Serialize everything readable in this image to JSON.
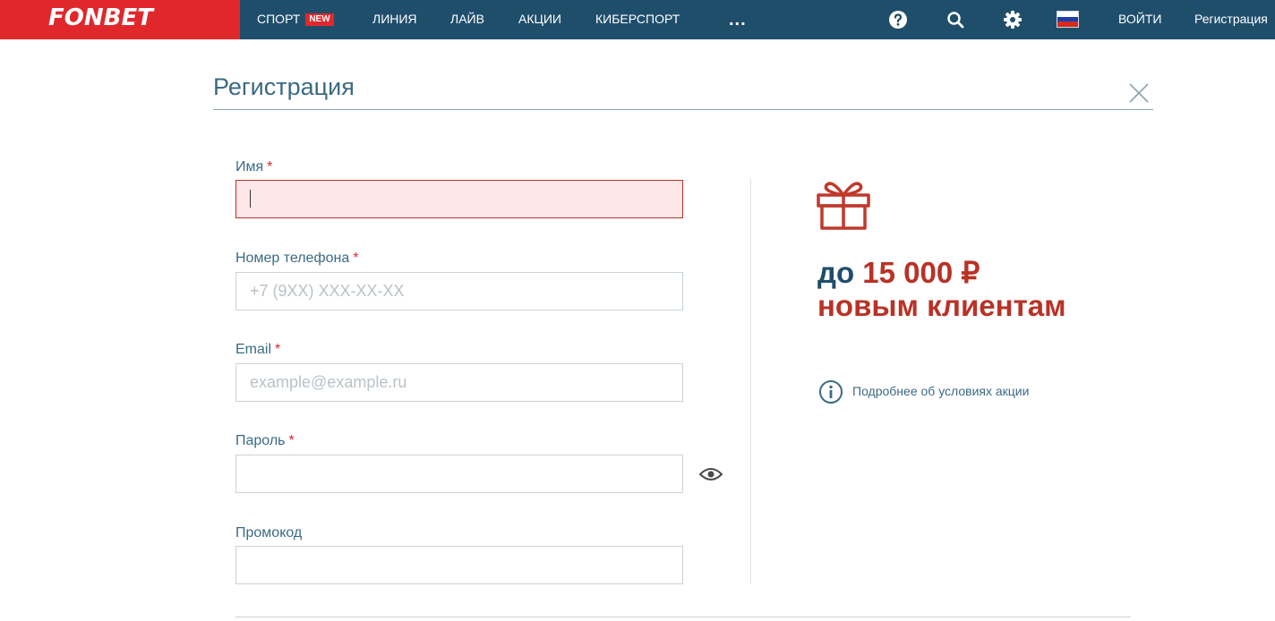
{
  "brand": {
    "logo": "FONBET",
    "primary_color": "#1f4e6b",
    "accent_color": "#e0282c"
  },
  "nav": {
    "items": [
      {
        "label": "СПОРТ",
        "badge": "NEW"
      },
      {
        "label": "ЛИНИЯ"
      },
      {
        "label": "ЛАЙВ"
      },
      {
        "label": "АКЦИИ"
      },
      {
        "label": "КИБЕРСПОРТ"
      }
    ],
    "more": "...",
    "icons": [
      "help-icon",
      "search-icon",
      "settings-icon",
      "flag-russia-icon"
    ],
    "login": "ВОЙТИ",
    "register": "Регистрация"
  },
  "page": {
    "title": "Регистрация",
    "close_icon": "close-icon"
  },
  "form": {
    "name": {
      "label": "Имя",
      "required": "*",
      "value": ""
    },
    "phone": {
      "label": "Номер телефона",
      "required": "*",
      "placeholder": "+7 (9XX) XXX-XX-XX"
    },
    "email": {
      "label": "Email",
      "required": "*",
      "placeholder": "example@example.ru"
    },
    "password": {
      "label": "Пароль",
      "required": "*",
      "icon": "eye-icon"
    },
    "promo": {
      "label": "Промокод"
    }
  },
  "promo": {
    "icon": "gift-icon",
    "prefix": "до",
    "amount": "15 000 ₽",
    "suffix": "новым клиентам",
    "info_text": "Подробнее об условиях акции",
    "info_icon": "info-icon"
  }
}
